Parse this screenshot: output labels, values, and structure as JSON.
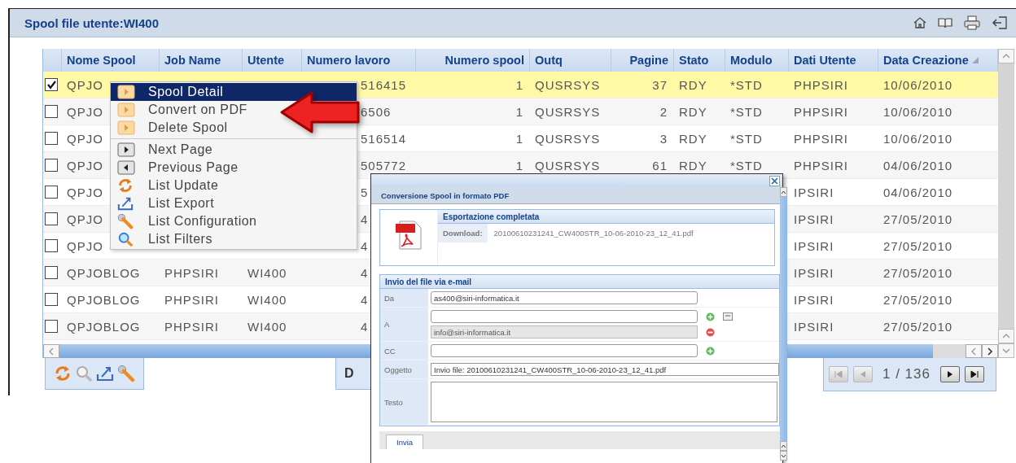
{
  "panel": {
    "title": "Spool file utente:WI400"
  },
  "columns": [
    {
      "label": "Nome Spool",
      "sorted": false
    },
    {
      "label": "Job Name",
      "sorted": false
    },
    {
      "label": "Utente",
      "sorted": false
    },
    {
      "label": "Numero lavoro",
      "sorted": false
    },
    {
      "label": "Numero spool",
      "sorted": false
    },
    {
      "label": "Outq",
      "sorted": false
    },
    {
      "label": "Pagine",
      "sorted": false
    },
    {
      "label": "Stato",
      "sorted": false
    },
    {
      "label": "Modulo",
      "sorted": false
    },
    {
      "label": "Dati Utente",
      "sorted": false
    },
    {
      "label": "Data Creazione",
      "sorted": true
    }
  ],
  "rows": [
    {
      "checked": true,
      "selected": true,
      "cells": [
        "QPJO",
        null,
        null,
        "516415",
        "1",
        "QUSRSYS",
        "37",
        "RDY",
        "*STD",
        "PHPSIRI",
        "10/06/2010"
      ]
    },
    {
      "checked": false,
      "selected": false,
      "cells": [
        "QPJO",
        null,
        null,
        "6506",
        "1",
        "QUSRSYS",
        "2",
        "RDY",
        "*STD",
        "PHPSIRI",
        "10/06/2010"
      ]
    },
    {
      "checked": false,
      "selected": false,
      "cells": [
        "QPJO",
        null,
        null,
        "516514",
        "1",
        "QUSRSYS",
        "3",
        "RDY",
        "*STD",
        "PHPSIRI",
        "10/06/2010"
      ]
    },
    {
      "checked": false,
      "selected": false,
      "cells": [
        "QPJO",
        null,
        null,
        "505772",
        "1",
        "QUSRSYS",
        "61",
        "RDY",
        "*STD",
        "PHPSIRI",
        "04/06/2010"
      ]
    },
    {
      "checked": false,
      "selected": false,
      "cells": [
        "QPJO",
        null,
        null,
        "5",
        null,
        null,
        null,
        null,
        null,
        "IPSIRI",
        "04/06/2010"
      ]
    },
    {
      "checked": false,
      "selected": false,
      "cells": [
        "QPJO",
        null,
        null,
        "4",
        null,
        null,
        null,
        null,
        null,
        "IPSIRI",
        "27/05/2010"
      ]
    },
    {
      "checked": false,
      "selected": false,
      "cells": [
        "QPJO",
        null,
        null,
        "4",
        null,
        null,
        null,
        null,
        null,
        "IPSIRI",
        "27/05/2010"
      ]
    },
    {
      "checked": false,
      "selected": false,
      "cells": [
        "QPJOBLOG",
        "PHPSIRI",
        "WI400",
        "4",
        null,
        null,
        null,
        null,
        null,
        "IPSIRI",
        "27/05/2010"
      ]
    },
    {
      "checked": false,
      "selected": false,
      "cells": [
        "QPJOBLOG",
        "PHPSIRI",
        "WI400",
        "4",
        null,
        null,
        null,
        null,
        null,
        "IPSIRI",
        "27/05/2010"
      ]
    },
    {
      "checked": false,
      "selected": false,
      "cells": [
        "QPJOBLOG",
        "PHPSIRI",
        "WI400",
        "4",
        null,
        null,
        null,
        null,
        null,
        "IPSIRI",
        "27/05/2010"
      ]
    }
  ],
  "toolbar": {
    "tools": [
      {
        "kind": "refresh"
      },
      {
        "kind": "search"
      },
      {
        "kind": "export"
      },
      {
        "kind": "configure"
      }
    ],
    "middle_text": "D"
  },
  "pager": {
    "left": [
      {
        "kind": "first",
        "disabled": true
      },
      {
        "kind": "previous",
        "disabled": true
      }
    ],
    "page": "1 / 136",
    "right": [
      {
        "kind": "next",
        "disabled": false
      },
      {
        "kind": "last",
        "disabled": false
      }
    ]
  },
  "context_menu": {
    "groups": [
      [
        {
          "label": "Spool Detail",
          "kind": "action",
          "selected": true
        },
        {
          "label": "Convert on PDF",
          "kind": "action",
          "selected": false
        },
        {
          "label": "Delete Spool",
          "kind": "action",
          "selected": false
        }
      ],
      [
        {
          "label": "Next Page",
          "kind": "next",
          "selected": false
        },
        {
          "label": "Previous Page",
          "kind": "previous",
          "selected": false
        },
        {
          "label": "List Update",
          "kind": "refresh",
          "selected": false
        },
        {
          "label": "List Export",
          "kind": "export",
          "selected": false
        },
        {
          "label": "List Configuration",
          "kind": "configure",
          "selected": false
        },
        {
          "label": "List Filters",
          "kind": "filter",
          "selected": false
        }
      ]
    ]
  },
  "dialog": {
    "title": "Conversione Spool in formato PDF",
    "export": {
      "title": "Esportazione completata",
      "download_label": "Download:",
      "file": "20100610231241_CW400STR_10-06-2010-23_12_41.pdf"
    },
    "email": {
      "title": "Invio del file via e-mail",
      "fields": [
        {
          "label": "Da",
          "kind": "text",
          "inputs": [
            {
              "value": "as400@siri-informatica.it",
              "disabled": false
            }
          ]
        },
        {
          "label": "A",
          "kind": "text",
          "inputs": [
            {
              "disabled": false,
              "actions": [
                {
                  "kind": "add"
                },
                {
                  "kind": "list"
                }
              ]
            },
            {
              "value": "info@siri-informatica.it",
              "disabled": true,
              "actions": [
                {
                  "kind": "remove"
                }
              ]
            }
          ]
        },
        {
          "label": "CC",
          "kind": "text",
          "inputs": [
            {
              "disabled": false,
              "actions": [
                {
                  "kind": "add"
                }
              ]
            }
          ]
        },
        {
          "label": "Oggetto",
          "kind": "wide",
          "inputs": [
            {
              "value": "Invio file: 20100610231241_CW400STR_10-06-2010-23_12_41.pdf",
              "disabled": false
            }
          ]
        },
        {
          "label": "Testo",
          "kind": "textarea"
        }
      ]
    },
    "send_button": "Invia"
  }
}
